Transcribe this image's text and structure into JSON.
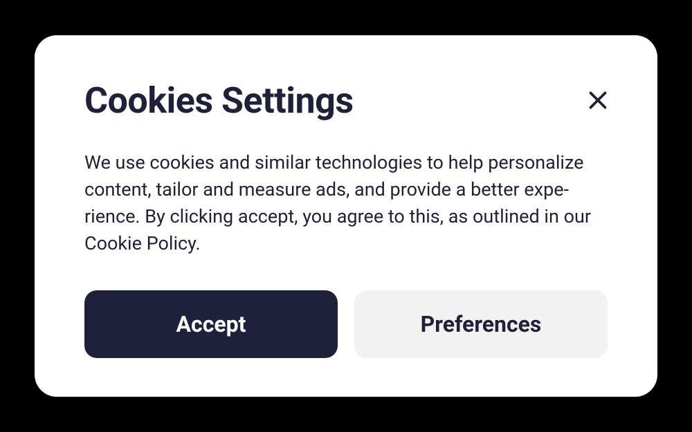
{
  "modal": {
    "title": "Cookies Settings",
    "body": "We use cookies and similar technologies to help personalize content, tailor and measure ads, and provide a better expe­rience. By clicking accept, you agree to this, as outlined in our Cookie Policy.",
    "accept_label": "Accept",
    "preferences_label": "Preferences"
  }
}
